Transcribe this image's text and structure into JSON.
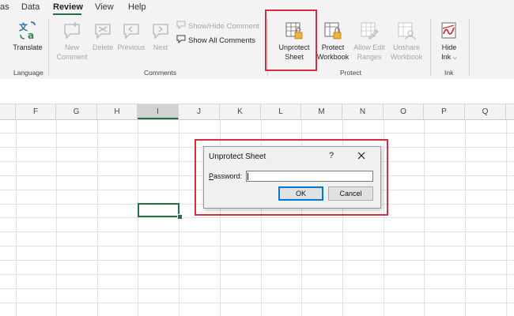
{
  "tabs": [
    {
      "label": "as",
      "active": false
    },
    {
      "label": "Data",
      "active": false
    },
    {
      "label": "Review",
      "active": true
    },
    {
      "label": "View",
      "active": false
    },
    {
      "label": "Help",
      "active": false
    }
  ],
  "ribbon": {
    "language": {
      "group_label": "Language",
      "translate": {
        "label": "Translate",
        "icon": "translate-icon"
      }
    },
    "comments": {
      "group_label": "Comments",
      "new_comment": {
        "label1": "New",
        "label2": "Comment",
        "enabled": false,
        "icon": "new-comment-icon"
      },
      "delete": {
        "label": "Delete",
        "enabled": false,
        "icon": "delete-comment-icon"
      },
      "previous": {
        "label": "Previous",
        "enabled": false,
        "icon": "previous-comment-icon"
      },
      "next": {
        "label": "Next",
        "enabled": false,
        "icon": "next-comment-icon"
      },
      "show_hide": {
        "label": "Show/Hide Comment",
        "enabled": false,
        "icon": "show-hide-comment-icon"
      },
      "show_all": {
        "label": "Show All Comments",
        "enabled": true,
        "icon": "show-all-comments-icon"
      }
    },
    "protect": {
      "group_label": "Protect",
      "unprotect_sheet": {
        "label1": "Unprotect",
        "label2": "Sheet",
        "enabled": true,
        "highlighted": true,
        "icon": "unprotect-sheet-icon"
      },
      "protect_workbook": {
        "label1": "Protect",
        "label2": "Workbook",
        "enabled": true,
        "icon": "protect-workbook-icon"
      },
      "allow_edit_ranges": {
        "label1": "Allow Edit",
        "label2": "Ranges",
        "enabled": false,
        "icon": "allow-edit-ranges-icon"
      },
      "unshare_workbook": {
        "label1": "Unshare",
        "label2": "Workbook",
        "enabled": false,
        "icon": "unshare-workbook-icon"
      }
    },
    "ink": {
      "group_label": "Ink",
      "hide_ink": {
        "label1": "Hide",
        "label2": "Ink",
        "icon": "hide-ink-icon"
      }
    }
  },
  "columns": [
    "F",
    "G",
    "H",
    "I",
    "J",
    "K",
    "L",
    "M",
    "N",
    "O",
    "P",
    "Q"
  ],
  "selected_column": "I",
  "dialog": {
    "title": "Unprotect Sheet",
    "help": "?",
    "password_label_underlined": "P",
    "password_label_rest": "assword:",
    "password_value": "",
    "ok_label": "OK",
    "cancel_label": "Cancel",
    "highlighted": true
  },
  "colors": {
    "accent_green": "#217346",
    "highlight_red": "#d32f3d",
    "ribbon_bg": "#f3f3f3",
    "ok_border": "#0078d7"
  }
}
